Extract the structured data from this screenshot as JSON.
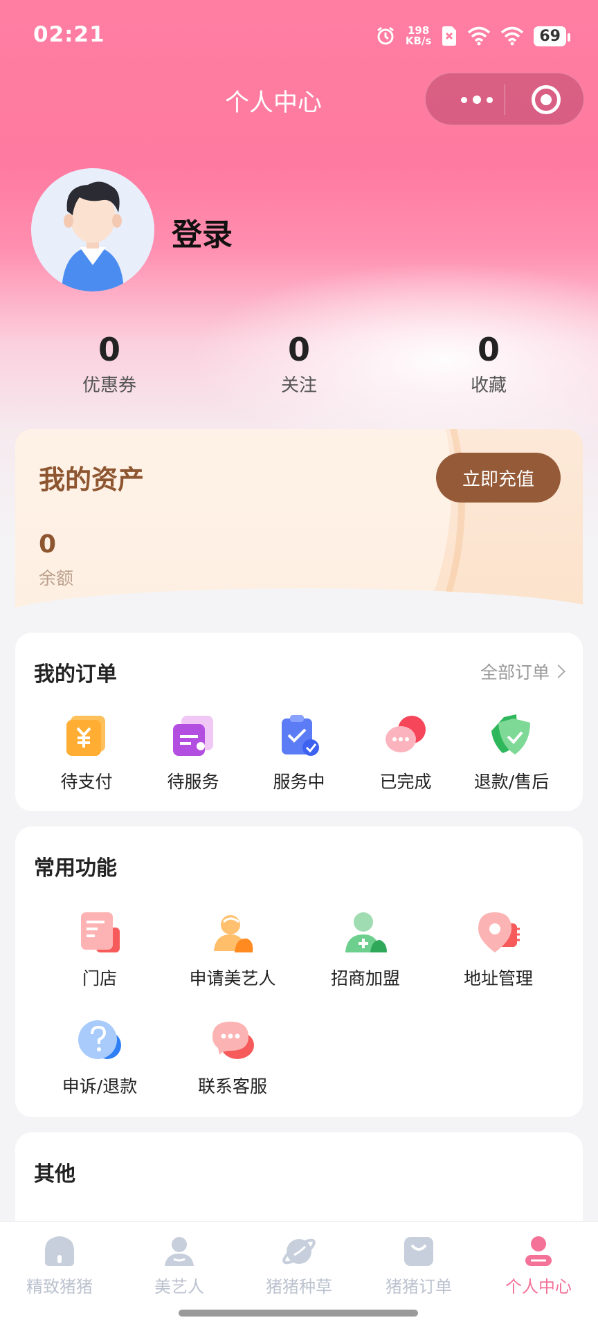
{
  "status_bar": {
    "time": "02:21",
    "net_speed_value": "198",
    "net_speed_unit": "KB/s",
    "battery": "69"
  },
  "header": {
    "title": "个人中心"
  },
  "profile": {
    "login_label": "登录"
  },
  "stats": [
    {
      "value": "0",
      "label": "优惠券"
    },
    {
      "value": "0",
      "label": "关注"
    },
    {
      "value": "0",
      "label": "收藏"
    }
  ],
  "assets": {
    "title": "我的资产",
    "recharge_label": "立即充值",
    "balance_value": "0",
    "balance_label": "余额"
  },
  "orders": {
    "title": "我的订单",
    "all_label": "全部订单",
    "items": [
      {
        "label": "待支付",
        "icon": "yuan-wallet-icon"
      },
      {
        "label": "待服务",
        "icon": "ticket-icon"
      },
      {
        "label": "服务中",
        "icon": "clipboard-check-icon"
      },
      {
        "label": "已完成",
        "icon": "chat-bubble-icon"
      },
      {
        "label": "退款/售后",
        "icon": "shield-check-icon"
      }
    ]
  },
  "functions": {
    "title": "常用功能",
    "items": [
      {
        "label": "门店",
        "icon": "store-doc-icon"
      },
      {
        "label": "申请美艺人",
        "icon": "artist-icon"
      },
      {
        "label": "招商加盟",
        "icon": "add-user-icon"
      },
      {
        "label": "地址管理",
        "icon": "location-pin-icon"
      },
      {
        "label": "申诉/退款",
        "icon": "question-icon"
      },
      {
        "label": "联系客服",
        "icon": "service-chat-icon"
      }
    ]
  },
  "other": {
    "title": "其他"
  },
  "tabbar": {
    "items": [
      {
        "label": "精致猪猪",
        "icon": "home-icon",
        "active": false
      },
      {
        "label": "美艺人",
        "icon": "person-icon",
        "active": false
      },
      {
        "label": "猪猪种草",
        "icon": "planet-icon",
        "active": false
      },
      {
        "label": "猪猪订单",
        "icon": "bag-icon",
        "active": false
      },
      {
        "label": "个人中心",
        "icon": "user-icon",
        "active": true
      }
    ]
  },
  "colors": {
    "primary_pink": "#ff7ea2",
    "active_tab": "#f47198",
    "asset_brown": "#955a37",
    "inactive_tab": "#bcc3cf"
  }
}
